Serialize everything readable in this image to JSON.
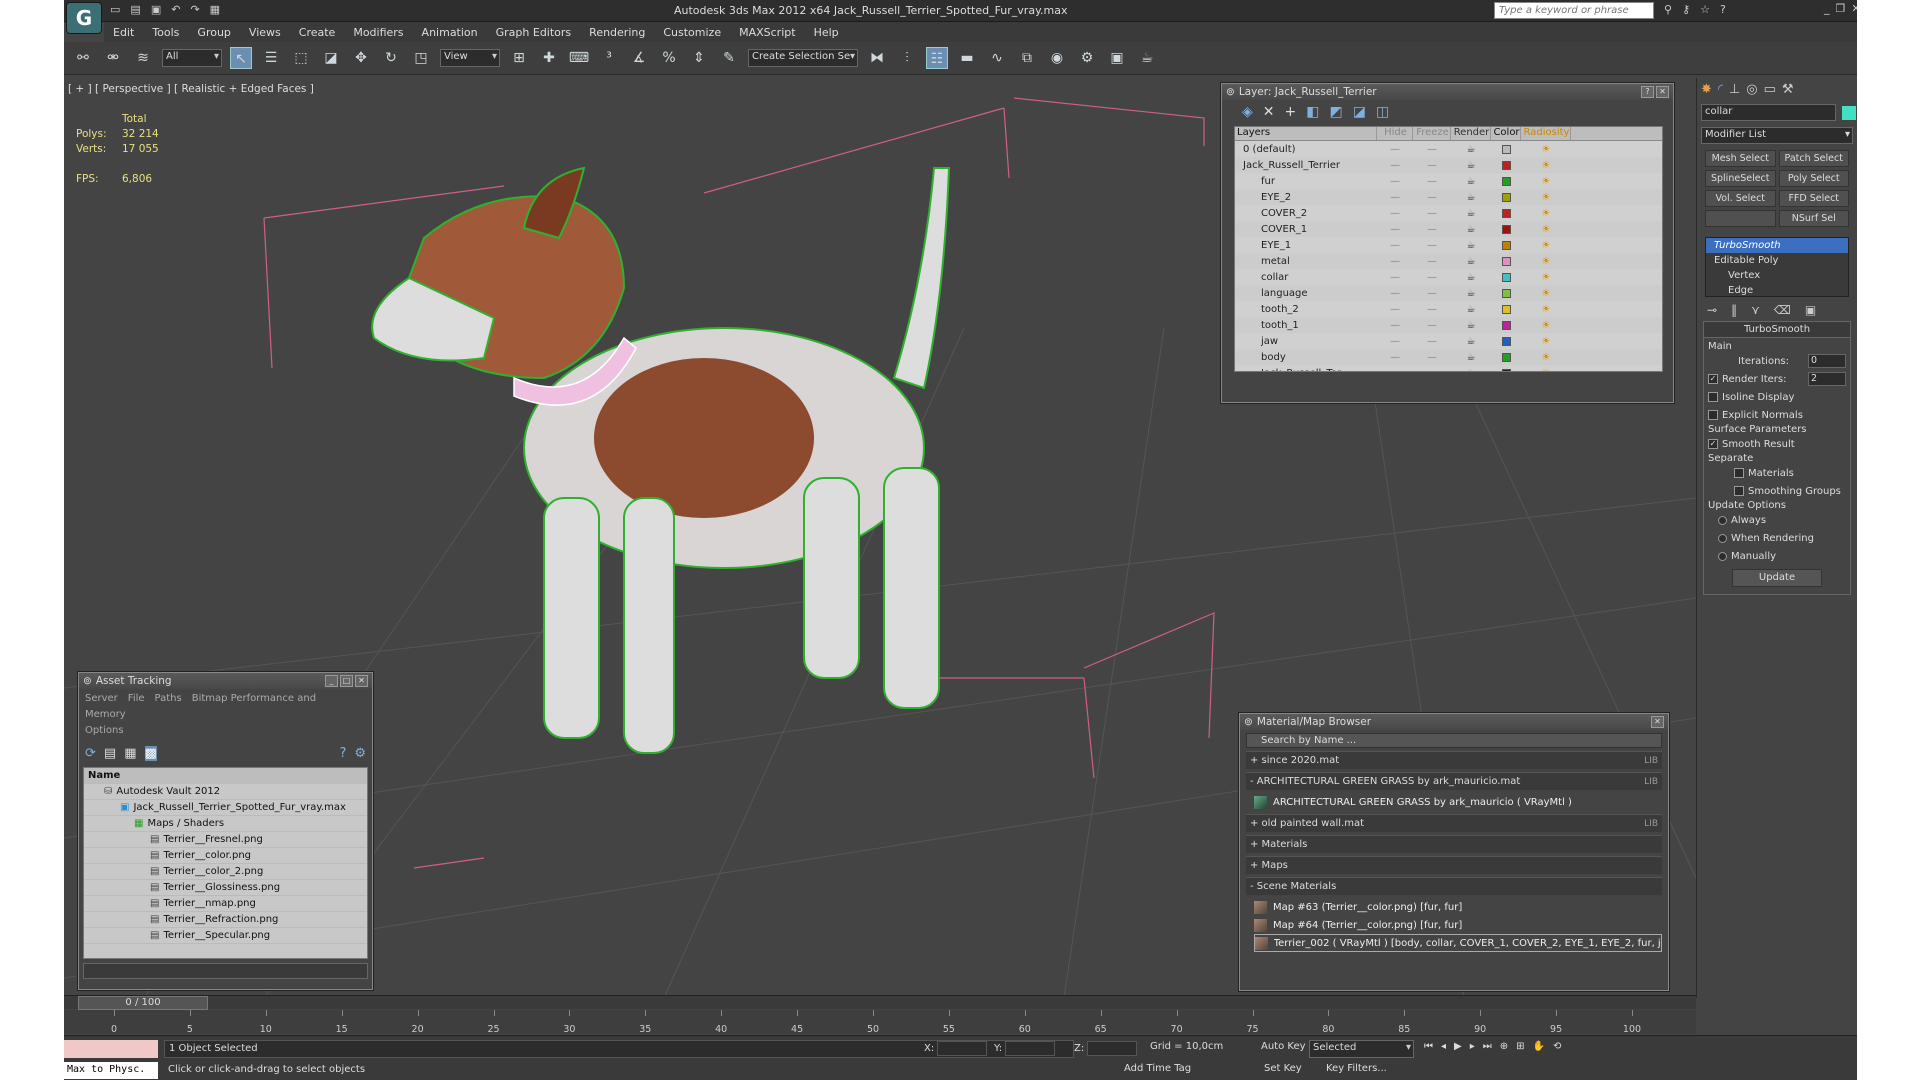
{
  "app": {
    "logo": "G",
    "title": "Autodesk 3ds Max  2012 x64      Jack_Russell_Terrier_Spotted_Fur_vray.max",
    "search_placeholder": "Type a keyword or phrase"
  },
  "menu": [
    "Edit",
    "Tools",
    "Group",
    "Views",
    "Create",
    "Modifiers",
    "Animation",
    "Graph Editors",
    "Rendering",
    "Customize",
    "MAXScript",
    "Help"
  ],
  "toolbar": {
    "filter": "All",
    "refcoord": "View",
    "selset": "Create Selection Se"
  },
  "viewport": {
    "label": "[ + ] [ Perspective ] [ Realistic + Edged Faces ]",
    "stats": {
      "header": "Total",
      "polys_label": "Polys:",
      "polys": "32 214",
      "verts_label": "Verts:",
      "verts": "17 055",
      "fps_label": "FPS:",
      "fps": "6,806"
    }
  },
  "layer_panel": {
    "title": "Layer: Jack_Russell_Terrier",
    "columns": [
      "Layers",
      "Hide",
      "Freeze",
      "Render",
      "Color",
      "Radiosity"
    ],
    "rows": [
      {
        "name": "0 (default)",
        "color": "#bbbbbb",
        "check": "☐"
      },
      {
        "name": "Jack_Russell_Terrier",
        "color": "#c02020",
        "check": "✓"
      },
      {
        "name": "fur",
        "color": "#20a020"
      },
      {
        "name": "EYE_2",
        "color": "#a0a000"
      },
      {
        "name": "COVER_2",
        "color": "#c02020"
      },
      {
        "name": "COVER_1",
        "color": "#a01010"
      },
      {
        "name": "EYE_1",
        "color": "#c08000"
      },
      {
        "name": "metal",
        "color": "#e090c0"
      },
      {
        "name": "collar",
        "color": "#40c0c0"
      },
      {
        "name": "language",
        "color": "#80c040"
      },
      {
        "name": "tooth_2",
        "color": "#e0c020"
      },
      {
        "name": "tooth_1",
        "color": "#c020a0"
      },
      {
        "name": "jaw",
        "color": "#2060c0"
      },
      {
        "name": "body",
        "color": "#20a020"
      },
      {
        "name": "Jack_Russell_Ter",
        "color": "#202020"
      }
    ]
  },
  "asset": {
    "title": "Asset Tracking",
    "menu": [
      "Server",
      "File",
      "Paths",
      "Bitmap Performance and Memory"
    ],
    "menu2": "Options",
    "col": "Name",
    "tree": [
      "Autodesk Vault 2012",
      "Jack_Russell_Terrier_Spotted_Fur_vray.max",
      "Maps / Shaders",
      "Terrier__Fresnel.png",
      "Terrier__color.png",
      "Terrier__color_2.png",
      "Terrier__Glossiness.png",
      "Terrier__nmap.png",
      "Terrier__Refraction.png",
      "Terrier__Specular.png"
    ]
  },
  "material": {
    "title": "Material/Map Browser",
    "search": "Search by Name ...",
    "sections": [
      {
        "label": "+ since 2020.mat",
        "lib": "LIB"
      },
      {
        "label": "- ARCHITECTURAL GREEN GRASS by ark_mauricio.mat",
        "lib": "LIB"
      }
    ],
    "grass_item": "ARCHITECTURAL GREEN GRASS by ark_mauricio  ( VRayMtl )",
    "sections2": [
      {
        "label": "+ old painted wall.mat",
        "lib": "LIB"
      },
      {
        "label": "+ Materials",
        "lib": ""
      },
      {
        "label": "+ Maps",
        "lib": ""
      },
      {
        "label": "- Scene Materials",
        "lib": ""
      }
    ],
    "scene": [
      "Map #63 (Terrier__color.png)  [fur, fur]",
      "Map #64 (Terrier__color.png)  [fur, fur]",
      "Terrier_002  ( VRayMtl )  [body, collar, COVER_1, COVER_2, EYE_1, EYE_2, fur, j..."
    ]
  },
  "cmd": {
    "objname": "collar",
    "modlist": "Modifier List",
    "buttons": [
      "Mesh Select",
      "Patch Select",
      "SplineSelect",
      "Poly Select",
      "Vol. Select",
      "FFD Select",
      "",
      "NSurf Sel"
    ],
    "stack": [
      "TurboSmooth",
      "Editable Poly",
      "Vertex",
      "Edge"
    ],
    "ts_title": "TurboSmooth",
    "main": "Main",
    "iter_label": "Iterations:",
    "iter": "0",
    "render_label": "Render Iters:",
    "render": "2",
    "isoline": "Isoline Display",
    "explicit": "Explicit Normals",
    "surface": "Surface Parameters",
    "smooth": "Smooth Result",
    "separate": "Separate",
    "materials": "Materials",
    "sgroups": "Smoothing Groups",
    "update_opts": "Update Options",
    "always": "Always",
    "when": "When Rendering",
    "manual": "Manually",
    "update": "Update"
  },
  "timeline": {
    "frame": "0 / 100",
    "ticks": [
      "0",
      "5",
      "10",
      "15",
      "20",
      "25",
      "30",
      "35",
      "40",
      "45",
      "50",
      "55",
      "60",
      "65",
      "70",
      "75",
      "80",
      "85",
      "90",
      "95",
      "100"
    ]
  },
  "status": {
    "selected": "1 Object Selected",
    "prompt": "Click or click-and-drag to select objects",
    "maxscript": "Max to Physc.",
    "x": "X:",
    "y": "Y:",
    "z": "Z:",
    "grid": "Grid = 10,0cm",
    "addtime": "Add Time Tag",
    "autokey": "Auto Key",
    "setkey": "Set Key",
    "selected_dd": "Selected",
    "keyfilters": "Key Filters...",
    "frame": "0"
  }
}
